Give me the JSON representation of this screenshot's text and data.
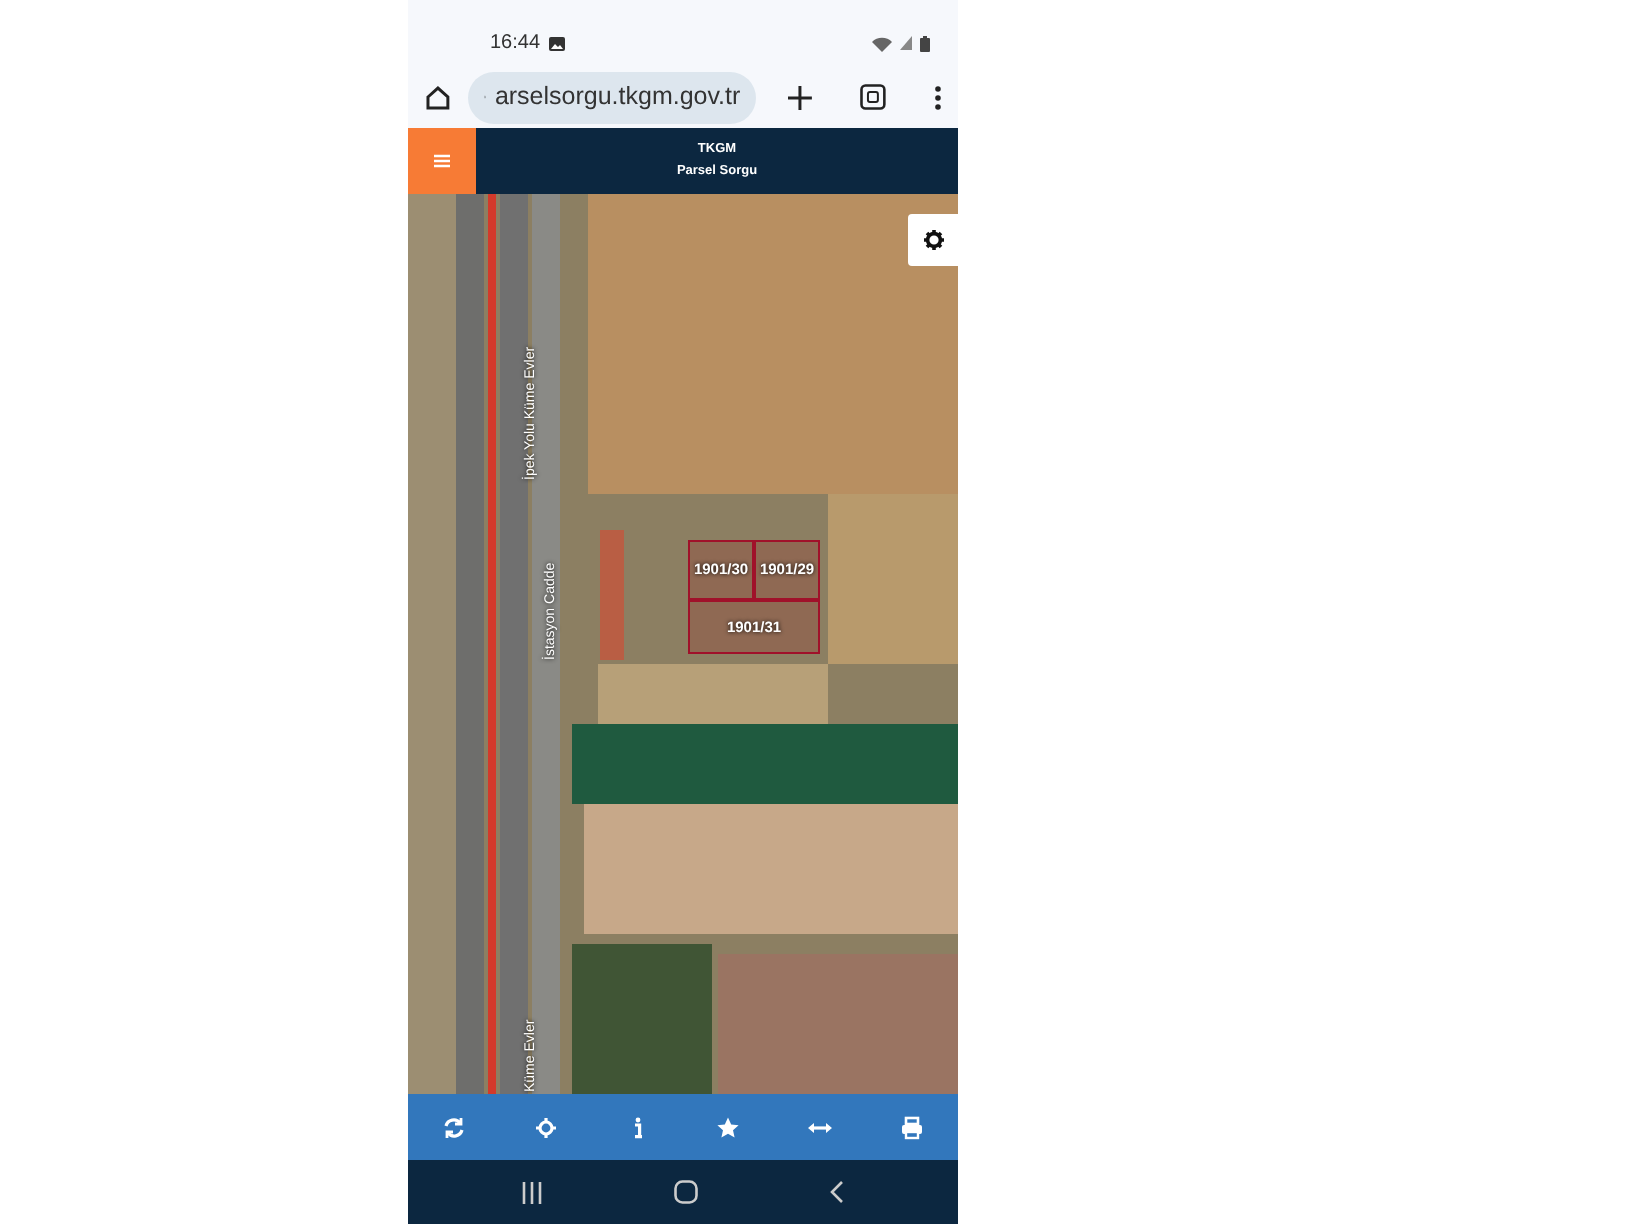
{
  "status_bar": {
    "time": "16:44"
  },
  "browser": {
    "url": "arselsorgu.tkgm.gov.tr"
  },
  "app_header": {
    "title": "TKGM",
    "subtitle": "Parsel Sorgu"
  },
  "map": {
    "street_labels": [
      {
        "text": "İpek Yolu Küme Evler"
      },
      {
        "text": "İstasyon Cadde"
      },
      {
        "text": "Küme Evler"
      }
    ],
    "parcels": [
      {
        "label": "1901/30"
      },
      {
        "label": "1901/29"
      },
      {
        "label": "1901/31"
      }
    ]
  },
  "toolbar": [
    {
      "kind": "refresh"
    },
    {
      "kind": "locate"
    },
    {
      "kind": "info"
    },
    {
      "kind": "star"
    },
    {
      "kind": "measure"
    },
    {
      "kind": "print"
    }
  ]
}
